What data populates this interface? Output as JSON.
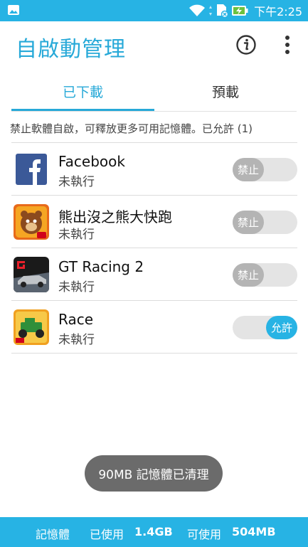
{
  "status_bar": {
    "time": "下午2:25",
    "icons": [
      "image-icon",
      "wifi-icon",
      "sd-card-icon",
      "battery-charging-icon"
    ]
  },
  "app_bar": {
    "title": "自啟動管理",
    "actions": [
      "info-icon",
      "more-vert-icon"
    ]
  },
  "tabs": [
    {
      "label": "已下載",
      "active": true
    },
    {
      "label": "預載",
      "active": false
    }
  ],
  "hint": "禁止軟體自啟，可釋放更多可用記憶體。已允許 (1)",
  "apps": [
    {
      "name": "Facebook",
      "status": "未執行",
      "toggle_label": "禁止",
      "allowed": false
    },
    {
      "name": "熊出沒之熊大快跑",
      "status": "未執行",
      "toggle_label": "禁止",
      "allowed": false
    },
    {
      "name": "GT Racing 2",
      "status": "未執行",
      "toggle_label": "禁止",
      "allowed": false
    },
    {
      "name": "Race",
      "status": "未執行",
      "toggle_label": "允許",
      "allowed": true
    }
  ],
  "toast": "90MB 記憶體已清理",
  "footer": {
    "memory_label": "記憶體",
    "used_label": "已使用",
    "used_value": "1.4GB",
    "available_label": "可使用",
    "available_value": "504MB"
  },
  "colors": {
    "accent": "#27b3e4",
    "toggle_off": "#b4b4b4",
    "toast_bg": "#6b6b6b"
  }
}
